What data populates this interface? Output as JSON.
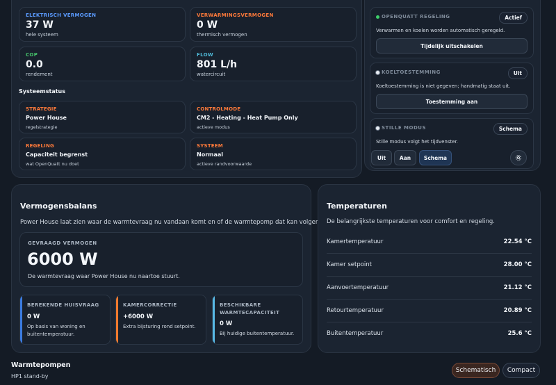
{
  "metrics": [
    {
      "label": "ELEKTRISCH VERMOGEN",
      "value": "37 W",
      "sub": "hele systeem"
    },
    {
      "label": "VERWARMINGSVERMOGEN",
      "value": "0 W",
      "sub": "thermisch vermogen"
    },
    {
      "label": "COP",
      "value": "0.0",
      "sub": "rendement"
    },
    {
      "label": "FLOW",
      "value": "801 L/h",
      "sub": "watercircuit"
    }
  ],
  "systeemstatus": {
    "title": "Systeemstatus",
    "items": [
      {
        "label": "STRATEGIE",
        "value": "Power House",
        "sub": "regelstrategie"
      },
      {
        "label": "CONTROLMODE",
        "value": "CM2 - Heating - Heat Pump Only",
        "sub": "actieve modus"
      },
      {
        "label": "REGELING",
        "value": "Capaciteit begrenst",
        "sub": "wat OpenQuatt nu doet"
      },
      {
        "label": "SYSTEEM",
        "value": "Normaal",
        "sub": "actieve randvoorwaarde"
      }
    ]
  },
  "controls": {
    "regeling": {
      "title": "OPENQUATT REGELING",
      "badge": "Actief",
      "desc": "Verwarmen en koelen worden automatisch geregeld.",
      "button": "Tijdelijk uitschakelen",
      "dot_color": "#3ecf6a"
    },
    "koel": {
      "title": "KOELTOESTEMMING",
      "badge": "Uit",
      "desc": "Koeltoestemming is niet gegeven; handmatig staat uit.",
      "button": "Toestemming aan",
      "dot_color": "#9aa6b4"
    },
    "stil": {
      "title": "STILLE MODUS",
      "badge": "Schema",
      "desc": "Stille modus volgt het tijdvenster.",
      "options": [
        "Uit",
        "Aan",
        "Schema"
      ],
      "selected": "Schema",
      "settings_icon": "gear-icon",
      "dot_color": "#9aa6b4"
    }
  },
  "vermogensbalans": {
    "title": "Vermogensbalans",
    "desc": "Power House laat zien waar de warmtevraag nu vandaan komt en of de warmtepomp dat kan volgen.",
    "gevraagd": {
      "label": "GEVRAAGD VERMOGEN",
      "value": "6000 W",
      "sub": "De warmtevraag waar Power House nu naartoe stuurt."
    },
    "cards": [
      {
        "title": "BEREKENDE HUISVRAAG",
        "value": "0 W",
        "sub": "Op basis van woning en buitentemperatuur.",
        "color": "#3b7be0"
      },
      {
        "title": "KAMERCORRECTIE",
        "value": "+6000 W",
        "sub": "Extra bijsturing rond setpoint.",
        "color": "#f07a2e"
      },
      {
        "title": "BESCHIKBARE WARMTECAPACITEIT",
        "value": "0 W",
        "sub": "Bij huidige buitentemperatuur.",
        "color": "#58b9e6"
      }
    ]
  },
  "temperaturen": {
    "title": "Temperaturen",
    "desc": "De belangrijkste temperaturen voor comfort en regeling.",
    "rows": [
      {
        "label": "Kamertemperatuur",
        "value": "22.54 °C"
      },
      {
        "label": "Kamer setpoint",
        "value": "28.00 °C"
      },
      {
        "label": "Aanvoertemperatuur",
        "value": "21.12 °C"
      },
      {
        "label": "Retourtemperatuur",
        "value": "20.89 °C"
      },
      {
        "label": "Buitentemperatuur",
        "value": "25.6 °C"
      }
    ]
  },
  "warmtepompen": {
    "title": "Warmtepompen",
    "sub": "HP1 stand-by",
    "views": [
      "Schematisch",
      "Compact"
    ],
    "selected": "Schematisch"
  }
}
